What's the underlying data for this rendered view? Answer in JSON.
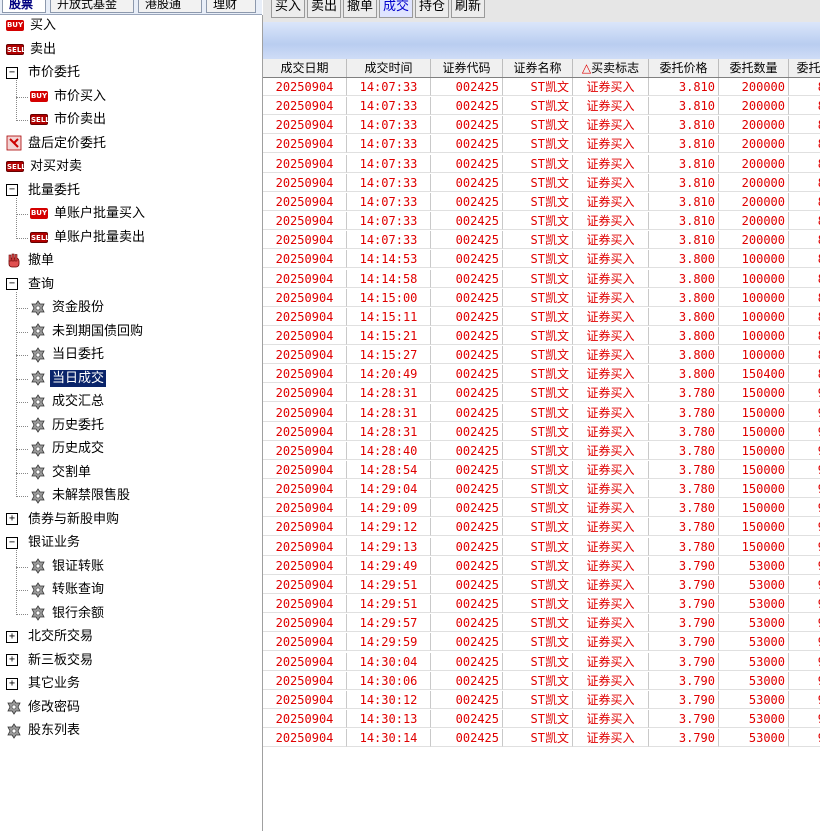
{
  "top_tabs": [
    "股票",
    "开放式基金",
    "港股通",
    "理财"
  ],
  "toolbar": [
    "买入",
    "卖出",
    "撤单",
    "成交",
    "持仓",
    "刷新"
  ],
  "toolbar_active": 3,
  "sidebar": [
    {
      "label": "买入",
      "icon": "buy",
      "level": 0
    },
    {
      "label": "卖出",
      "icon": "sell",
      "level": 0
    },
    {
      "label": "市价委托",
      "icon": "minus",
      "level": 0
    },
    {
      "label": "市价买入",
      "icon": "buy",
      "level": 1
    },
    {
      "label": "市价卖出",
      "icon": "sell",
      "level": 1
    },
    {
      "label": "盘后定价委托",
      "icon": "afterhours",
      "level": 0
    },
    {
      "label": "对买对卖",
      "icon": "sell",
      "level": 0
    },
    {
      "label": "批量委托",
      "icon": "minus",
      "level": 0
    },
    {
      "label": "单账户批量买入",
      "icon": "buy",
      "level": 1
    },
    {
      "label": "单账户批量卖出",
      "icon": "sell",
      "level": 1
    },
    {
      "label": "撤单",
      "icon": "hand",
      "level": 0
    },
    {
      "label": "查询",
      "icon": "minus",
      "level": 0
    },
    {
      "label": "资金股份",
      "icon": "gear",
      "level": 1
    },
    {
      "label": "未到期国债回购",
      "icon": "gear",
      "level": 1
    },
    {
      "label": "当日委托",
      "icon": "gear",
      "level": 1
    },
    {
      "label": "当日成交",
      "icon": "gear",
      "level": 1,
      "selected": true
    },
    {
      "label": "成交汇总",
      "icon": "gear",
      "level": 1
    },
    {
      "label": "历史委托",
      "icon": "gear",
      "level": 1
    },
    {
      "label": "历史成交",
      "icon": "gear",
      "level": 1
    },
    {
      "label": "交割单",
      "icon": "gear",
      "level": 1
    },
    {
      "label": "未解禁限售股",
      "icon": "gear",
      "level": 1
    },
    {
      "label": "债券与新股申购",
      "icon": "plus",
      "level": 0
    },
    {
      "label": "银证业务",
      "icon": "minus",
      "level": 0
    },
    {
      "label": "银证转账",
      "icon": "gear",
      "level": 1
    },
    {
      "label": "转账查询",
      "icon": "gear",
      "level": 1
    },
    {
      "label": "银行余额",
      "icon": "gear",
      "level": 1
    },
    {
      "label": "北交所交易",
      "icon": "plus",
      "level": 0
    },
    {
      "label": "新三板交易",
      "icon": "plus",
      "level": 0
    },
    {
      "label": "其它业务",
      "icon": "plus",
      "level": 0
    },
    {
      "label": "修改密码",
      "icon": "gear",
      "level": 0
    },
    {
      "label": "股东列表",
      "icon": "gear",
      "level": 0
    }
  ],
  "table": {
    "columns": [
      "成交日期",
      "成交时间",
      "证券代码",
      "证券名称",
      "买卖标志",
      "委托价格",
      "委托数量",
      "委托"
    ],
    "sort_marker": "△",
    "rows": [
      [
        "20250904",
        "14:07:33",
        "002425",
        "ST凯文",
        "证券买入",
        "3.810",
        "200000",
        "8"
      ],
      [
        "20250904",
        "14:07:33",
        "002425",
        "ST凯文",
        "证券买入",
        "3.810",
        "200000",
        "8"
      ],
      [
        "20250904",
        "14:07:33",
        "002425",
        "ST凯文",
        "证券买入",
        "3.810",
        "200000",
        "8"
      ],
      [
        "20250904",
        "14:07:33",
        "002425",
        "ST凯文",
        "证券买入",
        "3.810",
        "200000",
        "8"
      ],
      [
        "20250904",
        "14:07:33",
        "002425",
        "ST凯文",
        "证券买入",
        "3.810",
        "200000",
        "8"
      ],
      [
        "20250904",
        "14:07:33",
        "002425",
        "ST凯文",
        "证券买入",
        "3.810",
        "200000",
        "8"
      ],
      [
        "20250904",
        "14:07:33",
        "002425",
        "ST凯文",
        "证券买入",
        "3.810",
        "200000",
        "8"
      ],
      [
        "20250904",
        "14:07:33",
        "002425",
        "ST凯文",
        "证券买入",
        "3.810",
        "200000",
        "8"
      ],
      [
        "20250904",
        "14:07:33",
        "002425",
        "ST凯文",
        "证券买入",
        "3.810",
        "200000",
        "8"
      ],
      [
        "20250904",
        "14:14:53",
        "002425",
        "ST凯文",
        "证券买入",
        "3.800",
        "100000",
        "8"
      ],
      [
        "20250904",
        "14:14:58",
        "002425",
        "ST凯文",
        "证券买入",
        "3.800",
        "100000",
        "8"
      ],
      [
        "20250904",
        "14:15:00",
        "002425",
        "ST凯文",
        "证券买入",
        "3.800",
        "100000",
        "8"
      ],
      [
        "20250904",
        "14:15:11",
        "002425",
        "ST凯文",
        "证券买入",
        "3.800",
        "100000",
        "8"
      ],
      [
        "20250904",
        "14:15:21",
        "002425",
        "ST凯文",
        "证券买入",
        "3.800",
        "100000",
        "8"
      ],
      [
        "20250904",
        "14:15:27",
        "002425",
        "ST凯文",
        "证券买入",
        "3.800",
        "100000",
        "8"
      ],
      [
        "20250904",
        "14:20:49",
        "002425",
        "ST凯文",
        "证券买入",
        "3.800",
        "150400",
        "8"
      ],
      [
        "20250904",
        "14:28:31",
        "002425",
        "ST凯文",
        "证券买入",
        "3.780",
        "150000",
        "9"
      ],
      [
        "20250904",
        "14:28:31",
        "002425",
        "ST凯文",
        "证券买入",
        "3.780",
        "150000",
        "9"
      ],
      [
        "20250904",
        "14:28:31",
        "002425",
        "ST凯文",
        "证券买入",
        "3.780",
        "150000",
        "9"
      ],
      [
        "20250904",
        "14:28:40",
        "002425",
        "ST凯文",
        "证券买入",
        "3.780",
        "150000",
        "9"
      ],
      [
        "20250904",
        "14:28:54",
        "002425",
        "ST凯文",
        "证券买入",
        "3.780",
        "150000",
        "9"
      ],
      [
        "20250904",
        "14:29:04",
        "002425",
        "ST凯文",
        "证券买入",
        "3.780",
        "150000",
        "9"
      ],
      [
        "20250904",
        "14:29:09",
        "002425",
        "ST凯文",
        "证券买入",
        "3.780",
        "150000",
        "9"
      ],
      [
        "20250904",
        "14:29:12",
        "002425",
        "ST凯文",
        "证券买入",
        "3.780",
        "150000",
        "9"
      ],
      [
        "20250904",
        "14:29:13",
        "002425",
        "ST凯文",
        "证券买入",
        "3.780",
        "150000",
        "9"
      ],
      [
        "20250904",
        "14:29:49",
        "002425",
        "ST凯文",
        "证券买入",
        "3.790",
        "53000",
        "9"
      ],
      [
        "20250904",
        "14:29:51",
        "002425",
        "ST凯文",
        "证券买入",
        "3.790",
        "53000",
        "9"
      ],
      [
        "20250904",
        "14:29:51",
        "002425",
        "ST凯文",
        "证券买入",
        "3.790",
        "53000",
        "9"
      ],
      [
        "20250904",
        "14:29:57",
        "002425",
        "ST凯文",
        "证券买入",
        "3.790",
        "53000",
        "9"
      ],
      [
        "20250904",
        "14:29:59",
        "002425",
        "ST凯文",
        "证券买入",
        "3.790",
        "53000",
        "9"
      ],
      [
        "20250904",
        "14:30:04",
        "002425",
        "ST凯文",
        "证券买入",
        "3.790",
        "53000",
        "9"
      ],
      [
        "20250904",
        "14:30:06",
        "002425",
        "ST凯文",
        "证券买入",
        "3.790",
        "53000",
        "9"
      ],
      [
        "20250904",
        "14:30:12",
        "002425",
        "ST凯文",
        "证券买入",
        "3.790",
        "53000",
        "9"
      ],
      [
        "20250904",
        "14:30:13",
        "002425",
        "ST凯文",
        "证券买入",
        "3.790",
        "53000",
        "9"
      ],
      [
        "20250904",
        "14:30:14",
        "002425",
        "ST凯文",
        "证券买入",
        "3.790",
        "53000",
        "9"
      ]
    ]
  }
}
